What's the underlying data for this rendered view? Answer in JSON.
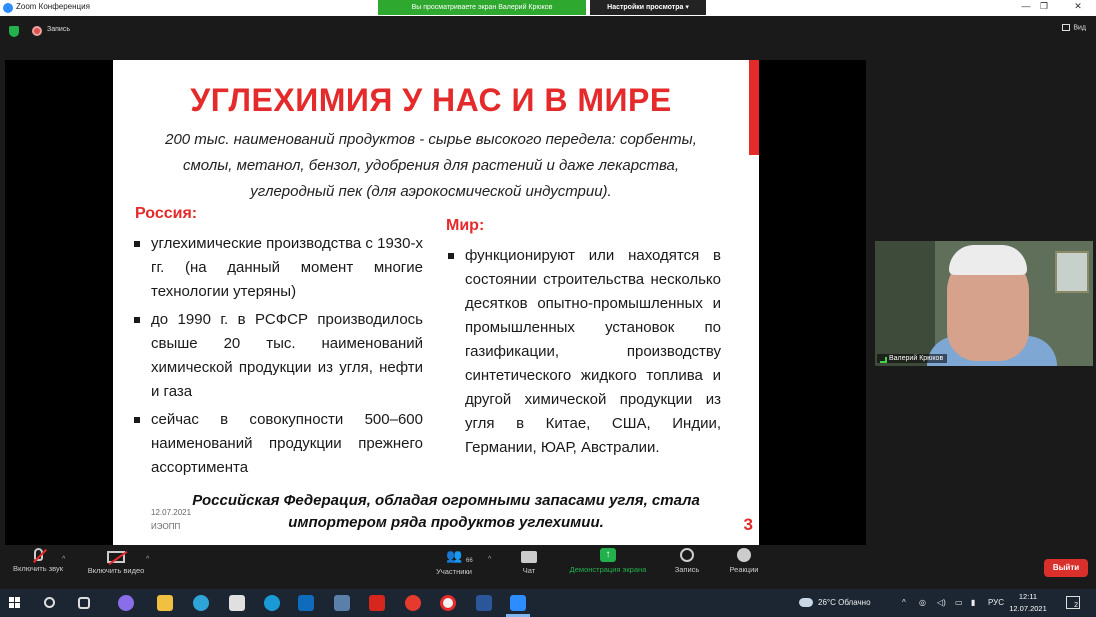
{
  "window": {
    "title": "Zoom Конференция",
    "share_banner": "Вы просматриваете экран Валерий Крюков",
    "view_options": "Настройки просмотра ▾",
    "minimize": "—",
    "maximize": "❐",
    "close": "✕"
  },
  "topbar": {
    "record_label": "Запись",
    "view_label": "Вид"
  },
  "slide": {
    "title": "УГЛЕХИМИЯ У НАС И В МИРЕ",
    "subtitle": "200 тыс. наименований продуктов - сырье высокого передела: сорбенты, смолы, метанол, бензол, удобрения для растений и даже лекарства, углеродный пек (для  аэрокосмической индустрии).",
    "left_heading": "Россия:",
    "left_bullets": [
      "углехимические производства с 1930-х гг. (на данный момент многие технологии утеряны)",
      "до 1990 г. в РСФСР производилось свыше 20 тыс. наименований химической продукции из угля, нефти и газа",
      "сейчас в совокупности 500–600 наименований продукции прежнего ассортимента"
    ],
    "right_heading": "Мир:",
    "right_bullets": [
      "функционируют или находятся в состоянии строительства несколько десятков опытно-промышленных и промышленных установок по газификации, производству синтетического жидкого топлива и другой химической продукции из угля в Китае, США, Индии, Германии, ЮАР, Австралии."
    ],
    "footer": "Российская Федерация, обладая огромными запасами угля, стала импортером ряда продуктов углехимии.",
    "date": "12.07.2021",
    "org": "ИЭОПП",
    "page_number": "3",
    "accent_color": "#e42a2a"
  },
  "participant": {
    "name": "Валерий Крюков"
  },
  "controls": {
    "mute": "Включить звук",
    "video": "Включить видео",
    "participants": "Участники",
    "participants_count": "66",
    "chat": "Чат",
    "share": "Демонстрация экрана",
    "record": "Запись",
    "reactions": "Реакции",
    "leave": "Выйти"
  },
  "taskbar": {
    "weather": "26°C  Облачно",
    "language": "РУС",
    "time": "12:11",
    "date": "12.07.2021",
    "notifications": "2"
  }
}
